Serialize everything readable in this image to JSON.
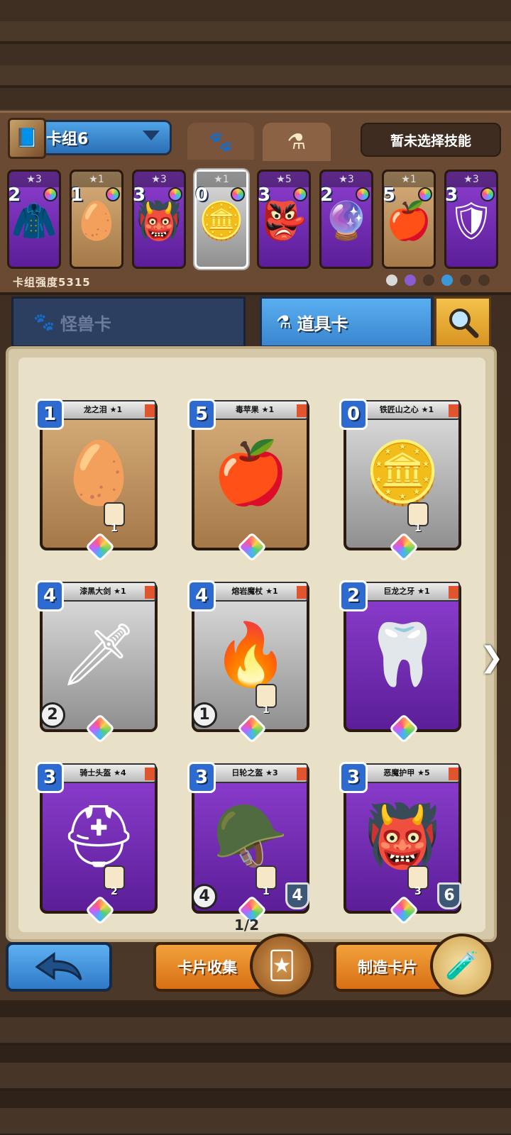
{
  "deck": {
    "name": "卡组6",
    "skill_button": "暂未选择技能",
    "strength_label": "卡组强度5315",
    "cards": [
      {
        "stars": "★3",
        "cost": "2",
        "icon": "coat-icon",
        "glyph": "🧥",
        "style": "purple"
      },
      {
        "stars": "★1",
        "cost": "1",
        "icon": "egg-icon",
        "glyph": "🥚",
        "style": "tan"
      },
      {
        "stars": "★3",
        "cost": "3",
        "icon": "demon-mask-icon",
        "glyph": "👹",
        "style": "purple"
      },
      {
        "stars": "★1",
        "cost": "0",
        "icon": "medallion-icon",
        "glyph": "🪙",
        "style": "gray"
      },
      {
        "stars": "★5",
        "cost": "3",
        "icon": "demon-armor-icon",
        "glyph": "👺",
        "style": "purple"
      },
      {
        "stars": "★3",
        "cost": "2",
        "icon": "orb-staff-icon",
        "glyph": "🔮",
        "style": "purple"
      },
      {
        "stars": "★1",
        "cost": "5",
        "icon": "poison-apple-icon",
        "glyph": "🍎",
        "style": "tan"
      },
      {
        "stars": "★3",
        "cost": "3",
        "icon": "shield-icon",
        "glyph": "🛡",
        "style": "purple"
      }
    ]
  },
  "categories": {
    "monster": "怪兽卡",
    "item": "道具卡"
  },
  "collection": {
    "page": "1/2",
    "cards": [
      {
        "title": "龙之泪 ★1",
        "cost": "1",
        "icon": "dragon-tear-icon",
        "glyph": "🥚",
        "style": "tan",
        "badge": "1"
      },
      {
        "title": "毒苹果 ★1",
        "cost": "5",
        "icon": "poison-apple-icon",
        "glyph": "🍎",
        "style": "tan",
        "badge": ""
      },
      {
        "title": "铁匠山之心 ★1",
        "cost": "0",
        "icon": "medallion-icon",
        "glyph": "🪙",
        "style": "gray",
        "badge": "1"
      },
      {
        "title": "漆黑大剑 ★1",
        "cost": "4",
        "icon": "black-sword-icon",
        "glyph": "🗡",
        "style": "gray",
        "weapon": "2"
      },
      {
        "title": "熔岩魔杖 ★1",
        "cost": "4",
        "icon": "lava-staff-icon",
        "glyph": "🔥",
        "style": "gray",
        "weapon": "1",
        "badge": "1"
      },
      {
        "title": "巨龙之牙 ★1",
        "cost": "2",
        "icon": "dragon-fang-icon",
        "glyph": "🦷",
        "style": "purple"
      },
      {
        "title": "骑士头盔 ★4",
        "cost": "3",
        "icon": "knight-helmet-icon",
        "glyph": "⛑",
        "style": "purple",
        "badge": "2"
      },
      {
        "title": "日轮之盔 ★3",
        "cost": "3",
        "icon": "sun-helmet-icon",
        "glyph": "🪖",
        "style": "purple",
        "weapon": "4",
        "shield": "4",
        "badge": "1"
      },
      {
        "title": "恶魔护甲 ★5",
        "cost": "3",
        "icon": "demon-armor-icon",
        "glyph": "👹",
        "style": "purple",
        "shield": "6",
        "badge": "3"
      }
    ]
  },
  "buttons": {
    "collect": "卡片收集",
    "craft": "制造卡片"
  }
}
